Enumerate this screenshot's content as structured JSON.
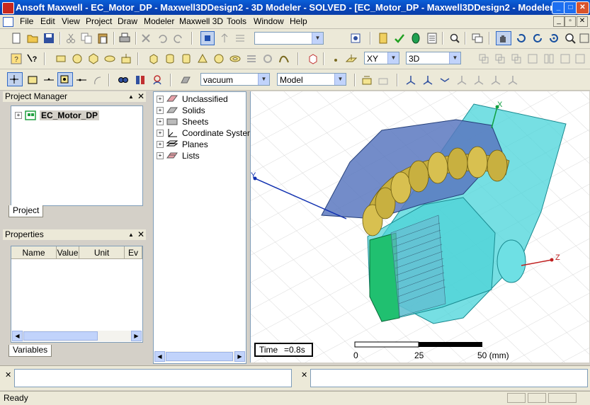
{
  "window": {
    "title": "Ansoft Maxwell  - EC_Motor_DP - Maxwell3DDesign2 - 3D Modeler - SOLVED - [EC_Motor_DP - Maxwell3DDesign2 - Modeler]"
  },
  "menu": [
    "File",
    "Edit",
    "View",
    "Project",
    "Draw",
    "Modeler",
    "Maxwell 3D",
    "Tools",
    "Window",
    "Help"
  ],
  "toolbar": {
    "plane_select": "XY",
    "dim_select": "3D",
    "material_select": "vacuum",
    "model_select": "Model"
  },
  "project_manager": {
    "title": "Project Manager",
    "project_name": "EC_Motor_DP",
    "tab": "Project"
  },
  "properties": {
    "title": "Properties",
    "columns": [
      "Name",
      "Value",
      "Unit",
      "Ev"
    ],
    "tab": "Variables"
  },
  "model_tree": {
    "items": [
      "Unclassified",
      "Solids",
      "Sheets",
      "Coordinate System",
      "Planes",
      "Lists"
    ]
  },
  "viewport": {
    "time_label": "Time",
    "time_value": "=0.8s",
    "axis_x": "X",
    "axis_y": "Y",
    "axis_z": "Z",
    "scale_0": "0",
    "scale_25": "25",
    "scale_50": "50 (mm)"
  },
  "status": {
    "text": "Ready"
  },
  "colors": {
    "titlebar": "#0a4fc8",
    "cyan_body": "#40d0d8",
    "blue_shell": "#6080c8",
    "gold_coils": "#c8b040",
    "green_part": "#20c870"
  }
}
